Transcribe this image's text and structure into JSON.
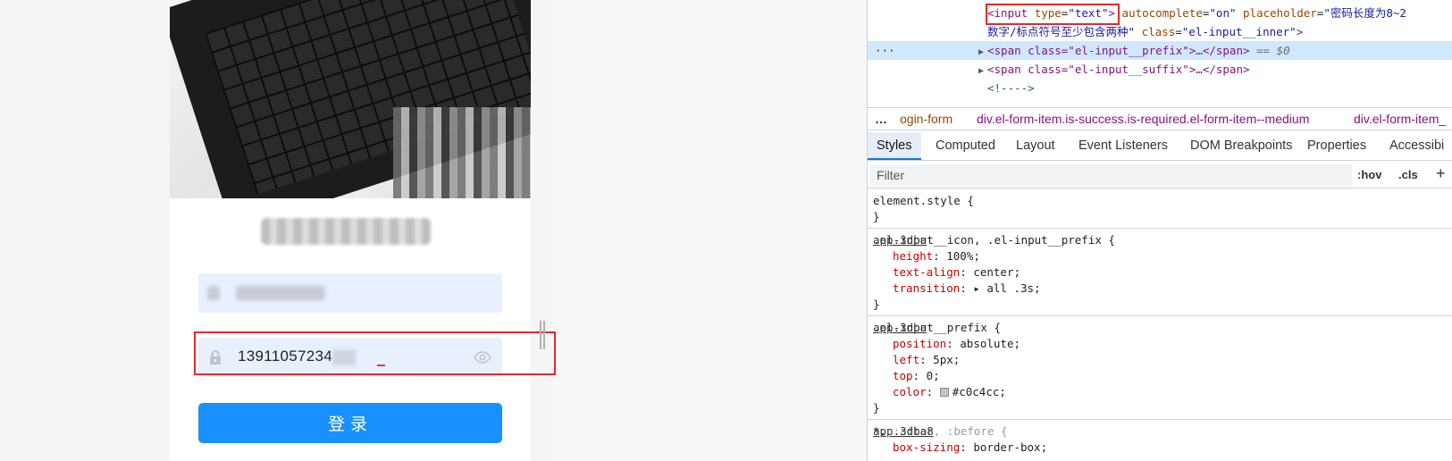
{
  "login": {
    "password_value": "13911057234",
    "login_button": "登录"
  },
  "devtools": {
    "dom": {
      "line1_tag_open": "<input",
      "line1_attr_type": "type",
      "line1_val_type": "\"text\"",
      "line1_tag_close_gt": ">",
      "line1_attr_autocomplete": "autocomplete",
      "line1_val_autocomplete": "\"on\"",
      "line1_attr_placeholder": "placeholder",
      "line1_val_placeholder": "\"密码长度为8~2",
      "line2_val_placeholder": "数字/标点符号至少包含两种\"",
      "line2_attr_class": "class",
      "line2_val_class": "\"el-input__inner\"",
      "line2_tag_close": ">",
      "line3_dots": "···",
      "line3_html": "<span class=\"el-input__prefix\">…</span>",
      "line3_eq": "== $0",
      "line4_html": "<span class=\"el-input__suffix\">…</span>",
      "line5_comment": "<!---->"
    },
    "breadcrumbs": {
      "more": "…",
      "items": [
        "ogin-form",
        "div.el-form-item.is-success.is-required.el-form-item--medium",
        "div.el-form-item_"
      ]
    },
    "tabs": [
      "Styles",
      "Computed",
      "Layout",
      "Event Listeners",
      "DOM Breakpoints",
      "Properties",
      "Accessibi"
    ],
    "active_tab": "Styles",
    "filter": {
      "placeholder": "Filter",
      "hov": ":hov",
      "cls": ".cls",
      "add": "+"
    },
    "rules": [
      {
        "selector": "element.style {",
        "close": "}"
      },
      {
        "selector": ".el-input__icon, .el-input__prefix {",
        "source": "app.3dba",
        "props": [
          {
            "name": "height",
            "value": "100%;"
          },
          {
            "name": "text-align",
            "value": "center;"
          },
          {
            "name": "transition",
            "value": "▸ all .3s;"
          }
        ],
        "close": "}"
      },
      {
        "selector": ".el-input__prefix {",
        "source": "app.3dba",
        "props": [
          {
            "name": "position",
            "value": "absolute;"
          },
          {
            "name": "left",
            "value": "5px;"
          },
          {
            "name": "top",
            "value": "0;"
          },
          {
            "name": "color",
            "value": "#c0c4cc;"
          }
        ],
        "close": "}"
      },
      {
        "selector_main": "*,",
        "selector_dim": " :after, :before {",
        "source": "app.3dba8",
        "props": [
          {
            "name": "box-sizing",
            "value": "border-box;"
          }
        ]
      }
    ]
  },
  "colors": {
    "primary": "#1890ff",
    "highlight": "#e5282e",
    "input_bg": "#e8f0fe",
    "icon": "#c0c4cc"
  }
}
